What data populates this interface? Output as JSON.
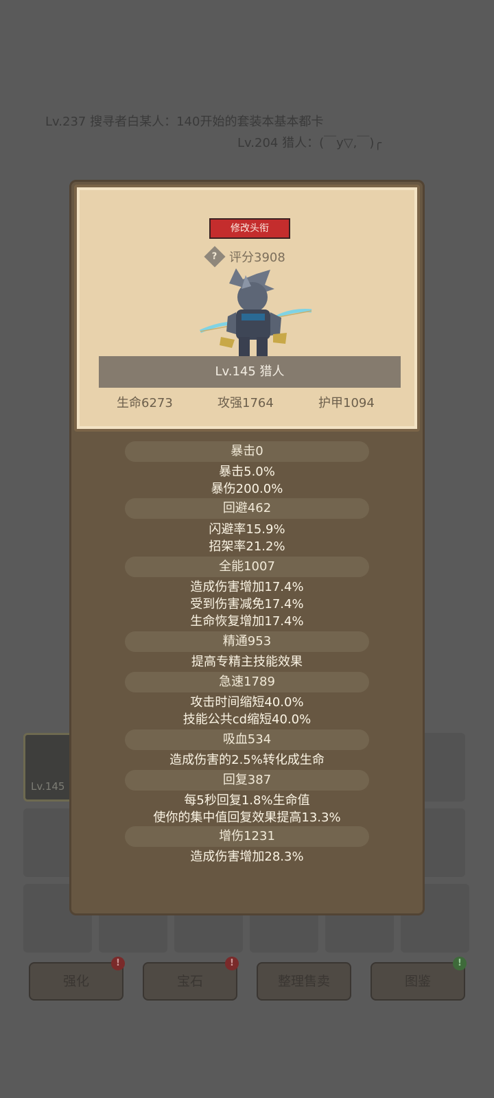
{
  "background": {
    "chat": [
      "Lv.237 搜寻者白某人：140开始的套装本基本都卡",
      "Lv.204 猎人：(￣y▽,￣)╭"
    ],
    "selected_slot_level": "Lv.145",
    "buttons": [
      {
        "label": "强化",
        "badge": "!"
      },
      {
        "label": "宝石",
        "badge": "!"
      },
      {
        "label": "整理售卖",
        "badge": ""
      },
      {
        "label": "图鉴",
        "badge": "!"
      }
    ]
  },
  "profile": {
    "title_button": "修改头衔",
    "help_icon": "?",
    "score": "评分3908",
    "name": "Lv.145 猎人",
    "hp": "生命6273",
    "attack": "攻强1764",
    "armor": "护甲1094"
  },
  "stats": [
    {
      "head": "暴击0",
      "lines": [
        "暴击5.0%",
        "暴伤200.0%"
      ]
    },
    {
      "head": "回避462",
      "lines": [
        "闪避率15.9%",
        "招架率21.2%"
      ]
    },
    {
      "head": "全能1007",
      "lines": [
        "造成伤害增加17.4%",
        "受到伤害减免17.4%",
        "生命恢复增加17.4%"
      ]
    },
    {
      "head": "精通953",
      "lines": [
        "提高专精主技能效果"
      ]
    },
    {
      "head": "急速1789",
      "lines": [
        "攻击时间缩短40.0%",
        "技能公共cd缩短40.0%"
      ]
    },
    {
      "head": "吸血534",
      "lines": [
        "造成伤害的2.5%转化成生命"
      ]
    },
    {
      "head": "回复387",
      "lines": [
        "每5秒回复1.8%生命值",
        "使你的集中值回复效果提高13.3%"
      ]
    },
    {
      "head": "增伤1231",
      "lines": [
        "造成伤害增加28.3%"
      ]
    }
  ],
  "colors": {
    "title_button": "#c42d2d",
    "card": "#e8d2ac",
    "panel": "#675742"
  }
}
